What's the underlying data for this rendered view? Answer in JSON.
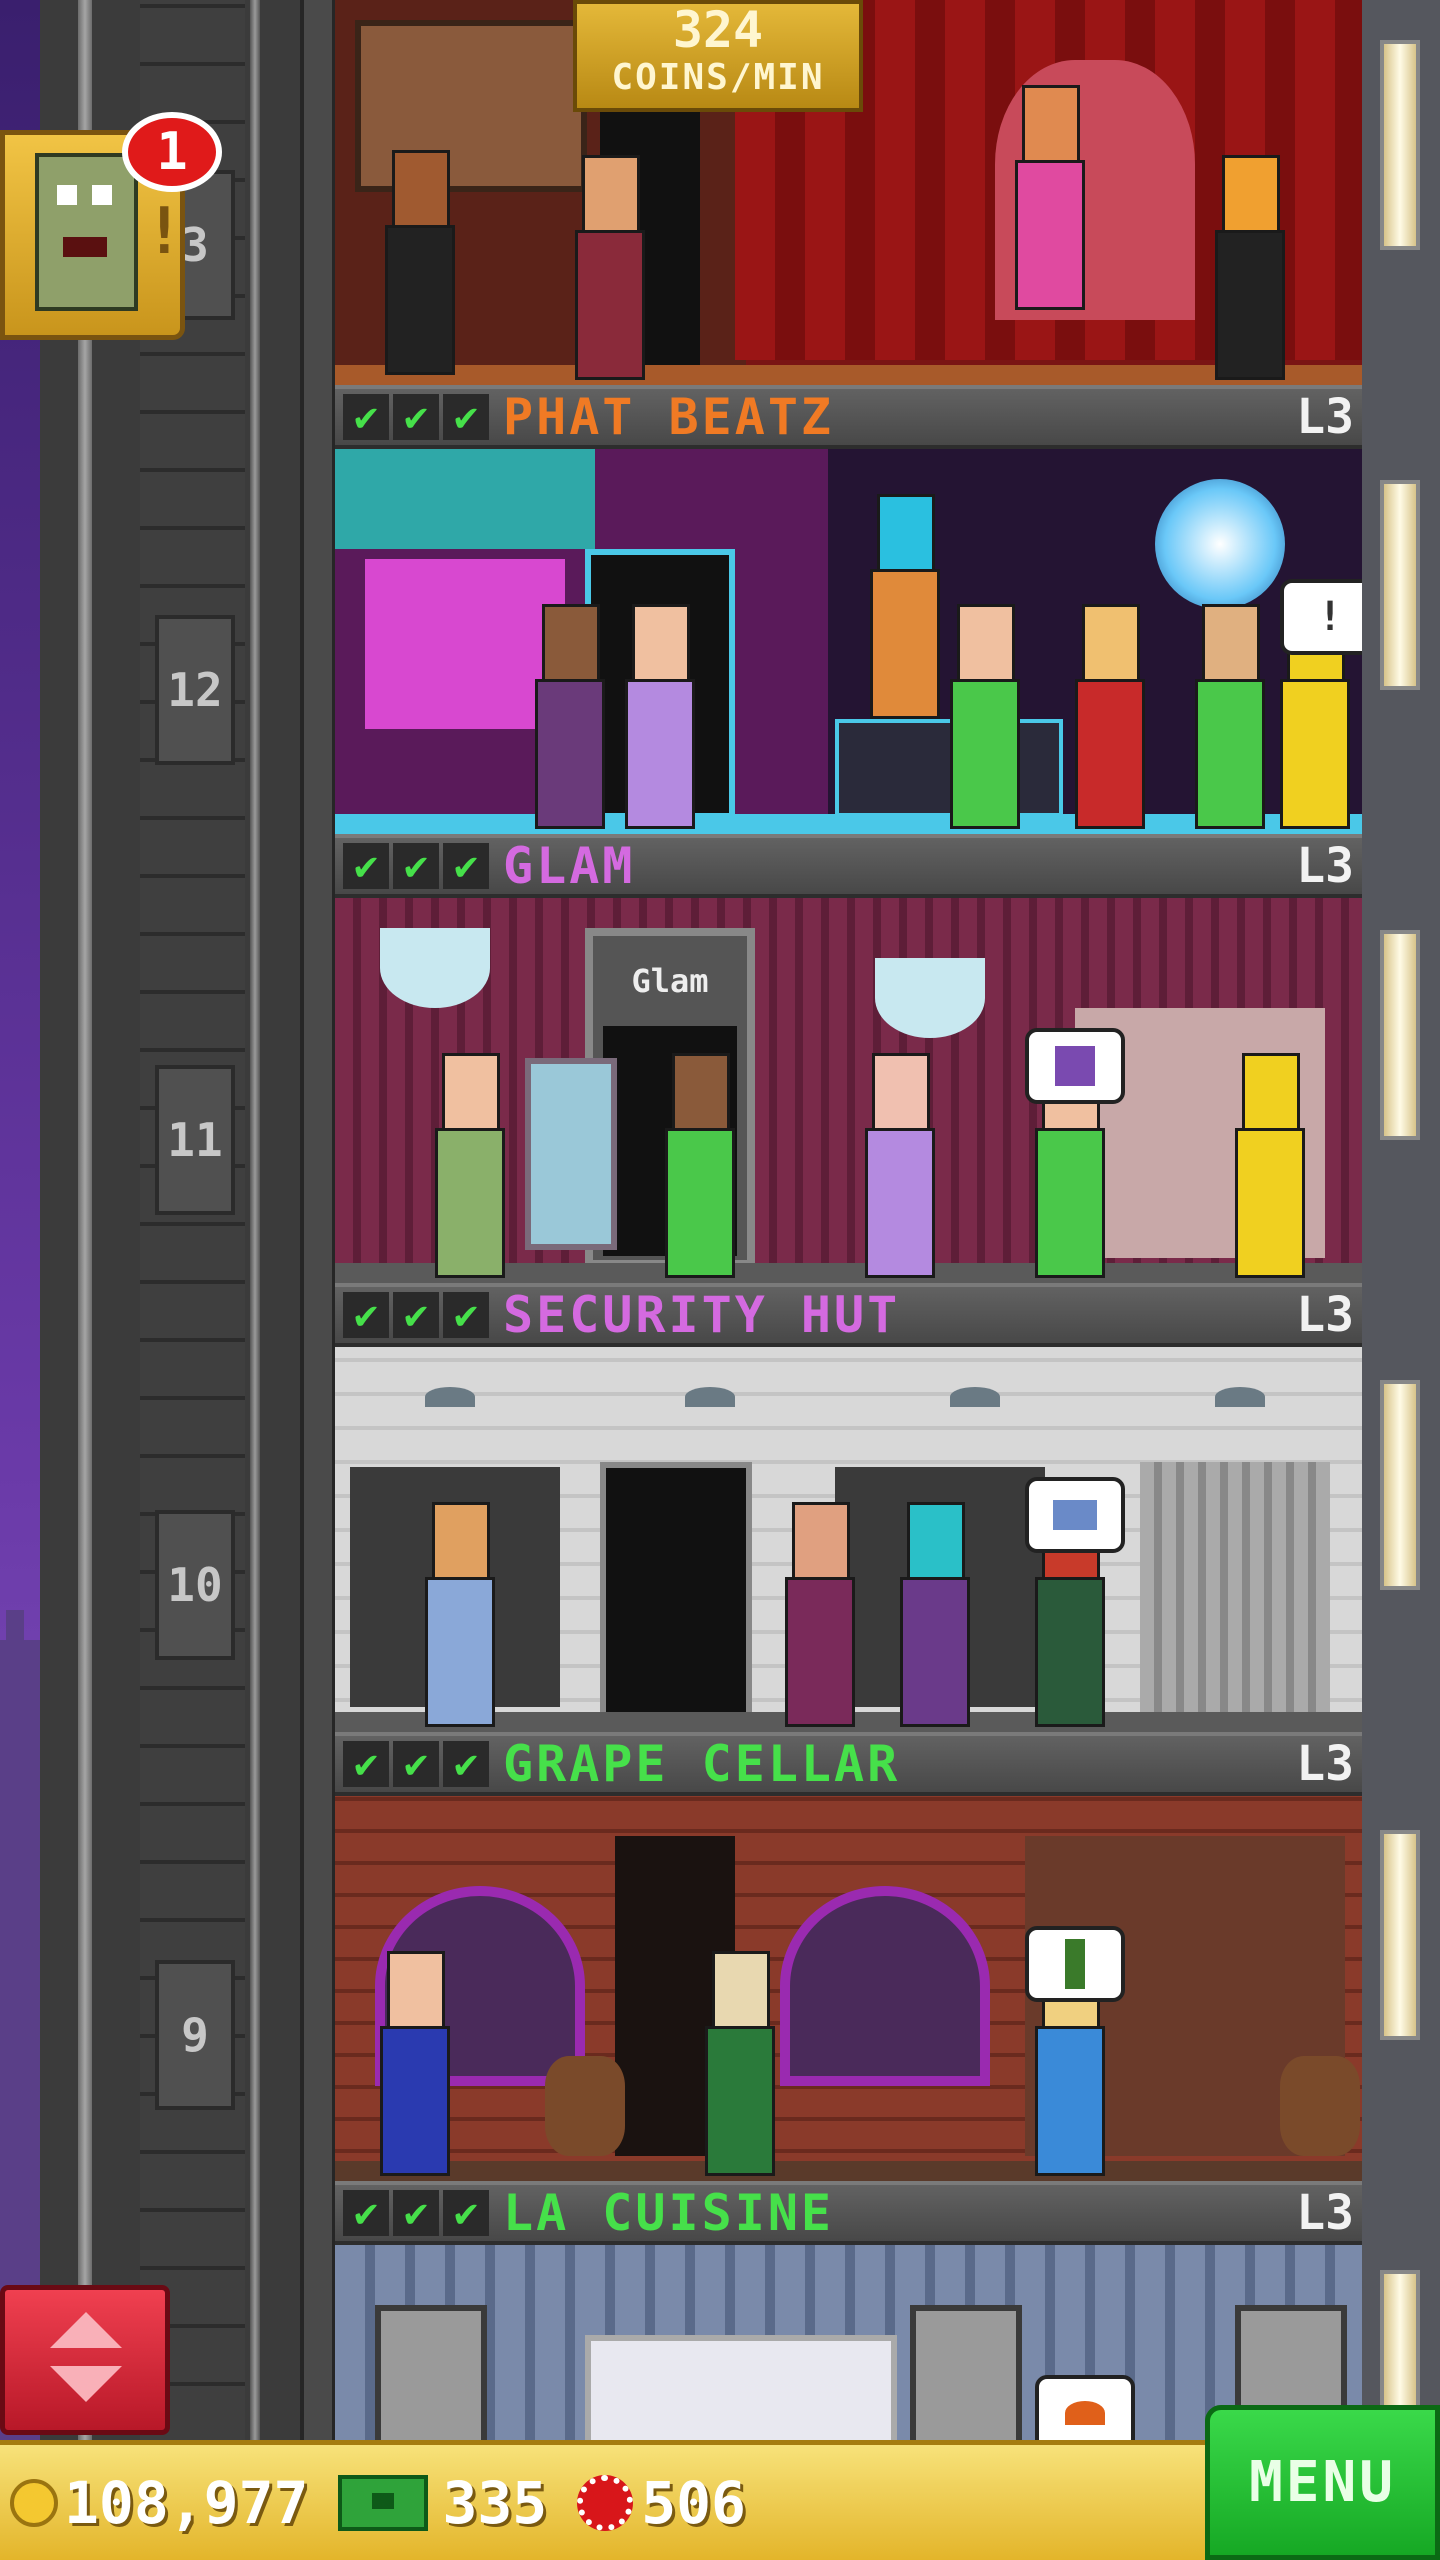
{
  "hud": {
    "coins_per_min_value": "324",
    "coins_per_min_label": "COINS/MIN"
  },
  "alert": {
    "badge_count": "1",
    "mark": "!"
  },
  "floor_numbers": [
    "3",
    "12",
    "11",
    "10",
    "9"
  ],
  "floors": [
    {
      "name": "PHAT BEATZ",
      "level": "L3",
      "stars": [
        "✔",
        "✔",
        "✔"
      ],
      "name_color": "#f07a24"
    },
    {
      "name": "GLAM",
      "level": "L3",
      "stars": [
        "✔",
        "✔",
        "✔"
      ],
      "name_color": "#d46ae0"
    },
    {
      "name": "SECURITY HUT",
      "level": "L3",
      "stars": [
        "✔",
        "✔",
        "✔"
      ],
      "name_color": "#d46ae0"
    },
    {
      "name": "GRAPE CELLAR",
      "level": "L3",
      "stars": [
        "✔",
        "✔",
        "✔"
      ],
      "name_color": "#46e04a"
    },
    {
      "name": "LA CUISINE",
      "level": "L3",
      "stars": [
        "✔",
        "✔",
        "✔"
      ],
      "name_color": "#46e04a"
    }
  ],
  "room_signs": {
    "glam_door_sign": "Glam"
  },
  "bubbles": {
    "phat_beatz": "!"
  },
  "bottom_bar": {
    "coins": "108,977",
    "bux": "335",
    "chips": "506",
    "menu_label": "MENU"
  },
  "colors": {
    "check_green": "#46e04a",
    "level_text": "#f2f2f2",
    "menu_green": "#22b832",
    "gold_bar": "#e8bf35"
  }
}
